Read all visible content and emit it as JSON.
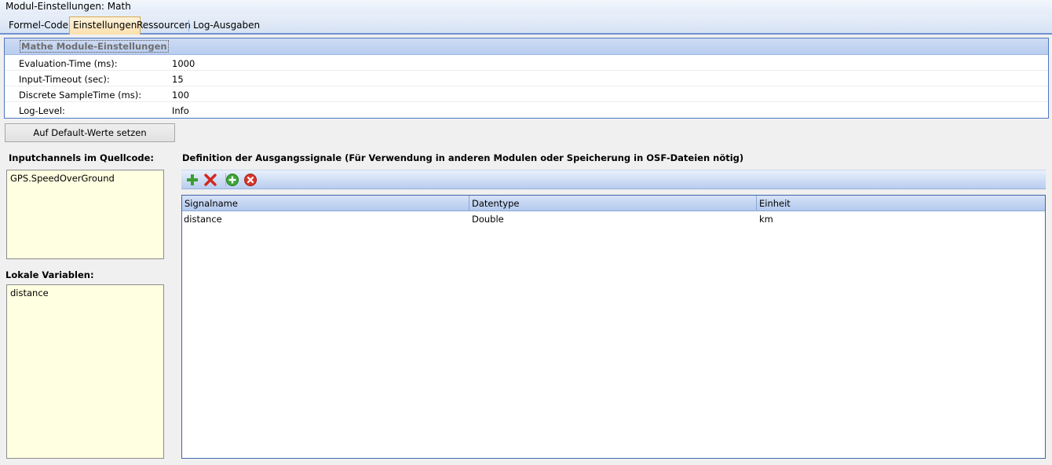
{
  "window": {
    "title": "Modul-Einstellungen: Math"
  },
  "tabs": [
    {
      "label": "Formel-Code"
    },
    {
      "label": "Einstellungen"
    },
    {
      "label": "Ressourcen"
    },
    {
      "label": "Log-Ausgaben"
    }
  ],
  "active_tab": "Einstellungen",
  "settings": {
    "section_title": "Mathe Module-Einstellungen",
    "rows": [
      {
        "key": "Evaluation-Time (ms):",
        "value": "1000"
      },
      {
        "key": "Input-Timeout (sec):",
        "value": "15"
      },
      {
        "key": "Discrete SampleTime (ms):",
        "value": "100"
      },
      {
        "key": "Log-Level:",
        "value": "Info"
      }
    ]
  },
  "default_button": {
    "label": "Auf Default-Werte setzen"
  },
  "inputchannels": {
    "label": "Inputchannels im Quellcode:",
    "items": [
      "GPS.SpeedOverGround"
    ]
  },
  "local_vars": {
    "label": "Lokale Variablen:",
    "items": [
      "distance"
    ]
  },
  "outputs": {
    "label": "Definition der Ausgangssignale (Für Verwendung in anderen Modulen oder Speicherung in OSF-Dateien nötig)",
    "toolbar": {
      "add_icon": "green-plus-icon",
      "delete_icon": "red-x-icon",
      "add_circle_icon": "green-circle-plus-icon",
      "remove_circle_icon": "red-circle-x-icon"
    },
    "columns": [
      "Signalname",
      "Datentype",
      "Einheit"
    ],
    "rows": [
      [
        "distance",
        "Double",
        "km"
      ]
    ]
  },
  "colors": {
    "accent_blue": "#4e77c2",
    "active_tab_bg": "#fbe0ae",
    "list_bg": "#ffffe1"
  }
}
